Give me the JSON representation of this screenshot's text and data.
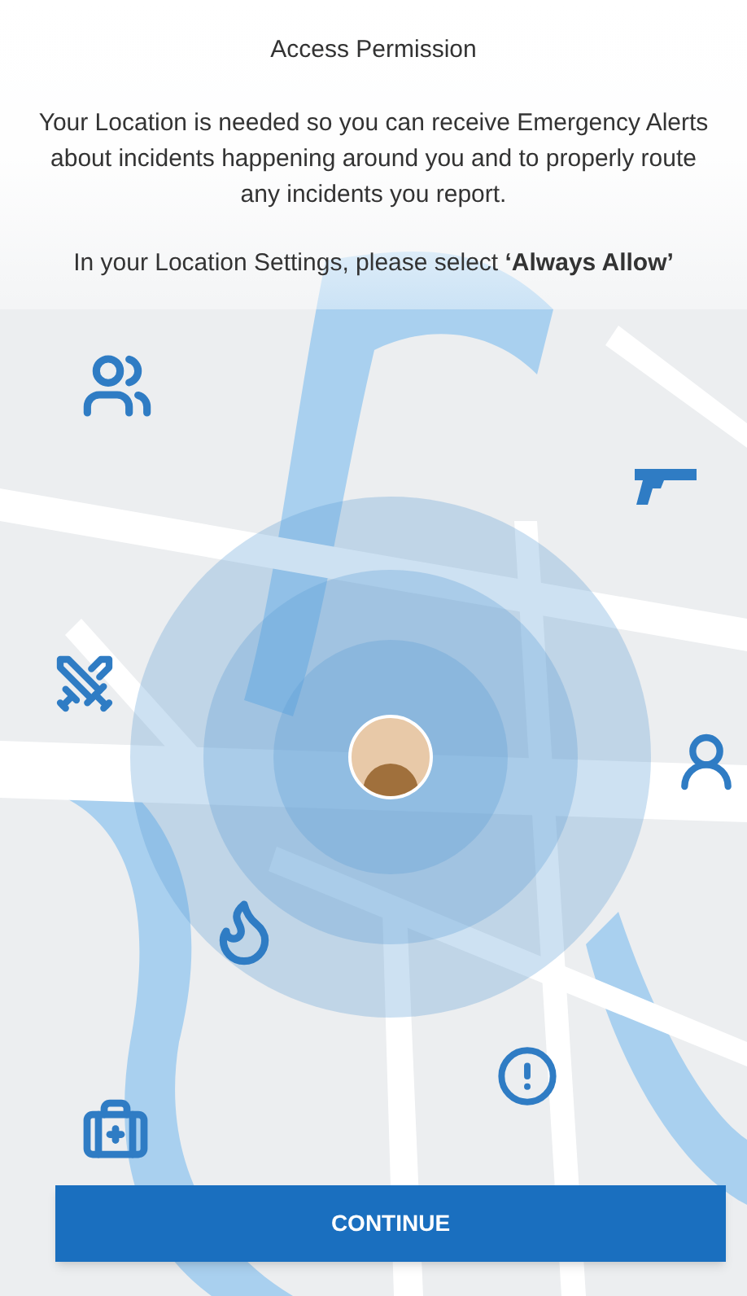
{
  "title": "Access Permission",
  "message": "Your Location is needed so you can receive Emergency Alerts about incidents happening around you and to properly route any incidents you report.",
  "instruction": "In your Location Settings, please select **‘Always Allow’**",
  "markers": [
    {
      "kind": "crowd"
    },
    {
      "kind": "gun"
    },
    {
      "kind": "fight"
    },
    {
      "kind": "suspect"
    },
    {
      "kind": "fire"
    },
    {
      "kind": "alert"
    },
    {
      "kind": "medical"
    }
  ],
  "button": "CONTINUE"
}
